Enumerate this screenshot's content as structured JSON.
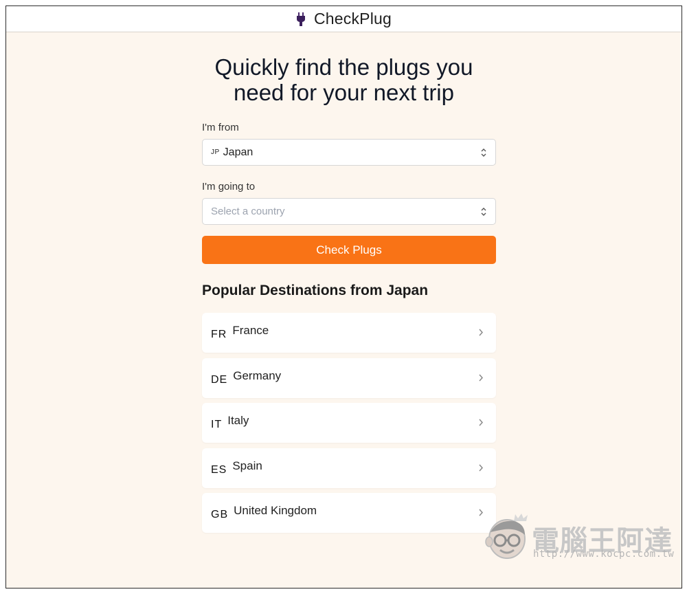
{
  "header": {
    "brand": "CheckPlug",
    "logo_icon": "plug-icon"
  },
  "hero": {
    "title_line1": "Quickly find the plugs you",
    "title_line2": "need for your next trip"
  },
  "form": {
    "from_label": "I'm from",
    "from_code": "JP",
    "from_value": "Japan",
    "to_label": "I'm going to",
    "to_placeholder": "Select a country",
    "button_label": "Check Plugs",
    "button_color": "#f97316"
  },
  "popular": {
    "title": "Popular Destinations from Japan",
    "items": [
      {
        "code": "FR",
        "name": "France"
      },
      {
        "code": "DE",
        "name": "Germany"
      },
      {
        "code": "IT",
        "name": "Italy"
      },
      {
        "code": "ES",
        "name": "Spain"
      },
      {
        "code": "GB",
        "name": "United Kingdom"
      }
    ]
  },
  "watermark": {
    "title": "電腦王阿達",
    "url": "http://www.kocpc.com.tw"
  }
}
